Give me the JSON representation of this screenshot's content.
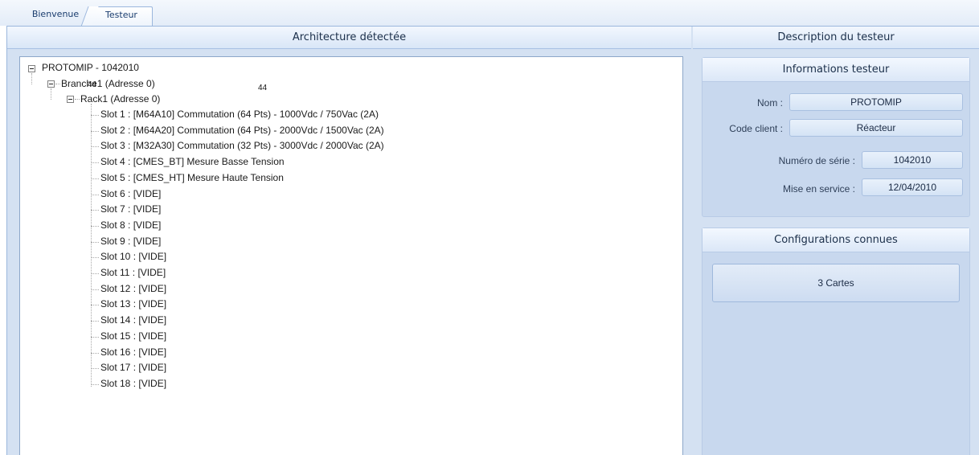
{
  "tabs": [
    {
      "label": "Bienvenue",
      "active": false
    },
    {
      "label": "Testeur",
      "active": true
    }
  ],
  "left_panel": {
    "title": "Architecture détectée",
    "tree": {
      "root": "PROTOMIP - 1042010",
      "branch": "Branche1 (Adresse 0)",
      "rack": "Rack1 (Adresse 0)",
      "slots": [
        "Slot 1 : [M64A10] Commutation (64 Pts) - 1000Vdc / 750Vac (2A)",
        "Slot 2 : [M64A20] Commutation (64 Pts) - 2000Vdc / 1500Vac (2A)",
        "Slot 3 : [M32A30] Commutation (32 Pts) - 3000Vdc / 2000Vac (2A)",
        "Slot 4 : [CMES_BT] Mesure Basse Tension",
        "Slot 5 : [CMES_HT] Mesure Haute Tension",
        "Slot 6 : [VIDE]",
        "Slot 7 : [VIDE]",
        "Slot 8 : [VIDE]",
        "Slot 9 : [VIDE]",
        "Slot 10 : [VIDE]",
        "Slot 11 : [VIDE]",
        "Slot 12 : [VIDE]",
        "Slot 13 : [VIDE]",
        "Slot 14 : [VIDE]",
        "Slot 15 : [VIDE]",
        "Slot 16 : [VIDE]",
        "Slot 17 : [VIDE]",
        "Slot 18 : [VIDE]"
      ]
    },
    "overlay_numbers": [
      "44",
      "44"
    ]
  },
  "right_panel": {
    "title": "Description du testeur",
    "info": {
      "title": "Informations testeur",
      "nom_label": "Nom :",
      "nom_value": "PROTOMIP",
      "client_label": "Code client :",
      "client_value": "Réacteur",
      "serie_label": "Numéro de série :",
      "serie_value": "1042010",
      "service_label": "Mise en service :",
      "service_value": "12/04/2010"
    },
    "configs": {
      "title": "Configurations connues",
      "button_label": "3 Cartes"
    }
  },
  "colors": {
    "panel_bg": "#d4e1f2",
    "header_text": "#1b2f4a",
    "tab_text": "#1a3d6e"
  }
}
